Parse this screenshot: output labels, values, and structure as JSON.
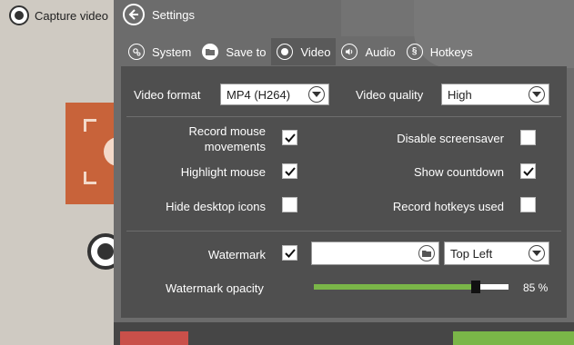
{
  "background_app": {
    "capture_label": "Capture video"
  },
  "settings": {
    "title": "Settings",
    "tabs": [
      {
        "label": "System",
        "icon": "gear-icon"
      },
      {
        "label": "Save to",
        "icon": "folder-icon"
      },
      {
        "label": "Video",
        "icon": "radio-dot-icon",
        "active": true
      },
      {
        "label": "Audio",
        "icon": "speaker-icon"
      },
      {
        "label": "Hotkeys",
        "icon": "hotkey-icon"
      }
    ],
    "video": {
      "format_label": "Video format",
      "format_value": "MP4 (H264)",
      "quality_label": "Video quality",
      "quality_value": "High",
      "options": {
        "record_mouse_line1": "Record mouse",
        "record_mouse_line2": "movements",
        "record_mouse_checked": true,
        "disable_screensaver": "Disable screensaver",
        "disable_screensaver_checked": false,
        "highlight_mouse": "Highlight mouse",
        "highlight_mouse_checked": true,
        "show_countdown": "Show countdown",
        "show_countdown_checked": true,
        "hide_desktop_icons": "Hide desktop icons",
        "hide_desktop_icons_checked": false,
        "record_hotkeys": "Record hotkeys used",
        "record_hotkeys_checked": false
      },
      "watermark_label": "Watermark",
      "watermark_checked": true,
      "watermark_path": "",
      "watermark_position": "Top Left",
      "opacity_label": "Watermark opacity",
      "opacity_value": 0.85,
      "opacity_text": "85 %"
    }
  },
  "colors": {
    "accent_green": "#7ab648",
    "danger_red": "#c9504a",
    "panel_bg": "#6c6c6c",
    "content_bg": "#4f4f4f"
  }
}
